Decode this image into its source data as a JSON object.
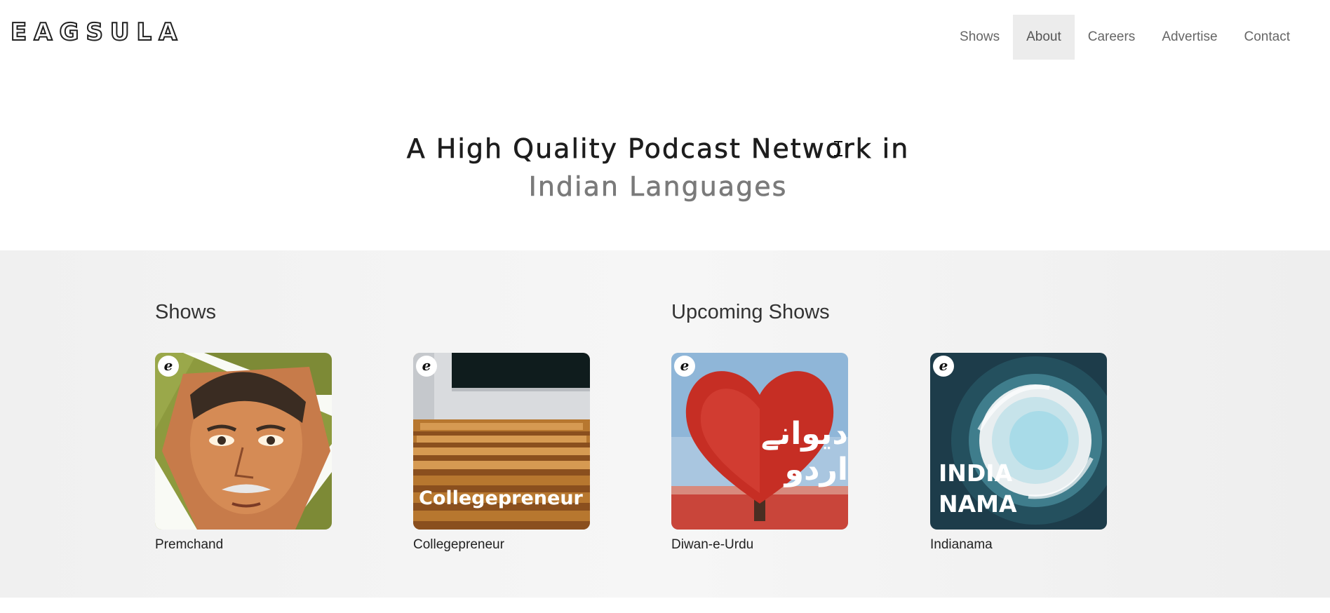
{
  "header": {
    "logo": "EAGSULA",
    "nav": [
      {
        "label": "Shows",
        "active": false
      },
      {
        "label": "About",
        "active": true
      },
      {
        "label": "Careers",
        "active": false
      },
      {
        "label": "Advertise",
        "active": false
      },
      {
        "label": "Contact",
        "active": false
      }
    ]
  },
  "hero": {
    "line1": "A High Quality Podcast Network in",
    "line2": "Indian Languages"
  },
  "shows": {
    "heading": "Shows",
    "items": [
      {
        "title": "Premchand",
        "badge": "e"
      },
      {
        "title": "Collegepreneur",
        "badge": "e",
        "art_text": "Collegepreneur"
      }
    ]
  },
  "upcoming": {
    "heading": "Upcoming Shows",
    "items": [
      {
        "title": "Diwan-e-Urdu",
        "badge": "e",
        "art_text": "دیوانے اردو"
      },
      {
        "title": "Indianama",
        "badge": "e",
        "art_text_line1": "INDIA",
        "art_text_line2": "NAMA"
      }
    ]
  },
  "colors": {
    "accent_active": "#ececec",
    "hero_dark": "#1d1d1d",
    "hero_grey": "#7a7a7a"
  }
}
